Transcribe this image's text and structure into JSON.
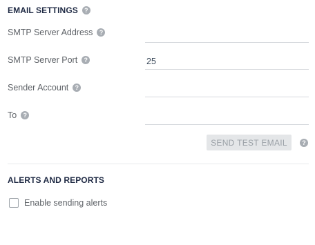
{
  "email_settings": {
    "title": "EMAIL SETTINGS",
    "help_glyph": "?",
    "fields": [
      {
        "label": "SMTP Server Address",
        "value": "",
        "placeholder": ""
      },
      {
        "label": "SMTP Server Port",
        "value": "25",
        "placeholder": ""
      },
      {
        "label": "Sender Account",
        "value": "",
        "placeholder": ""
      },
      {
        "label": "To",
        "value": "",
        "placeholder": ""
      }
    ],
    "send_test_button": "SEND TEST EMAIL"
  },
  "alerts": {
    "title": "ALERTS AND REPORTS",
    "enable_alerts_label": "Enable sending alerts",
    "enable_alerts_checked": false
  },
  "colors": {
    "heading": "#1f2a44",
    "label": "#5f6368",
    "help_icon": "#a8adb3",
    "button_bg": "#e4e6e8",
    "button_text": "#9aa0a6",
    "underline": "#d5d8dc"
  },
  "icons": {
    "help": "question-circle-icon",
    "checkbox": "checkbox-unchecked-icon"
  }
}
